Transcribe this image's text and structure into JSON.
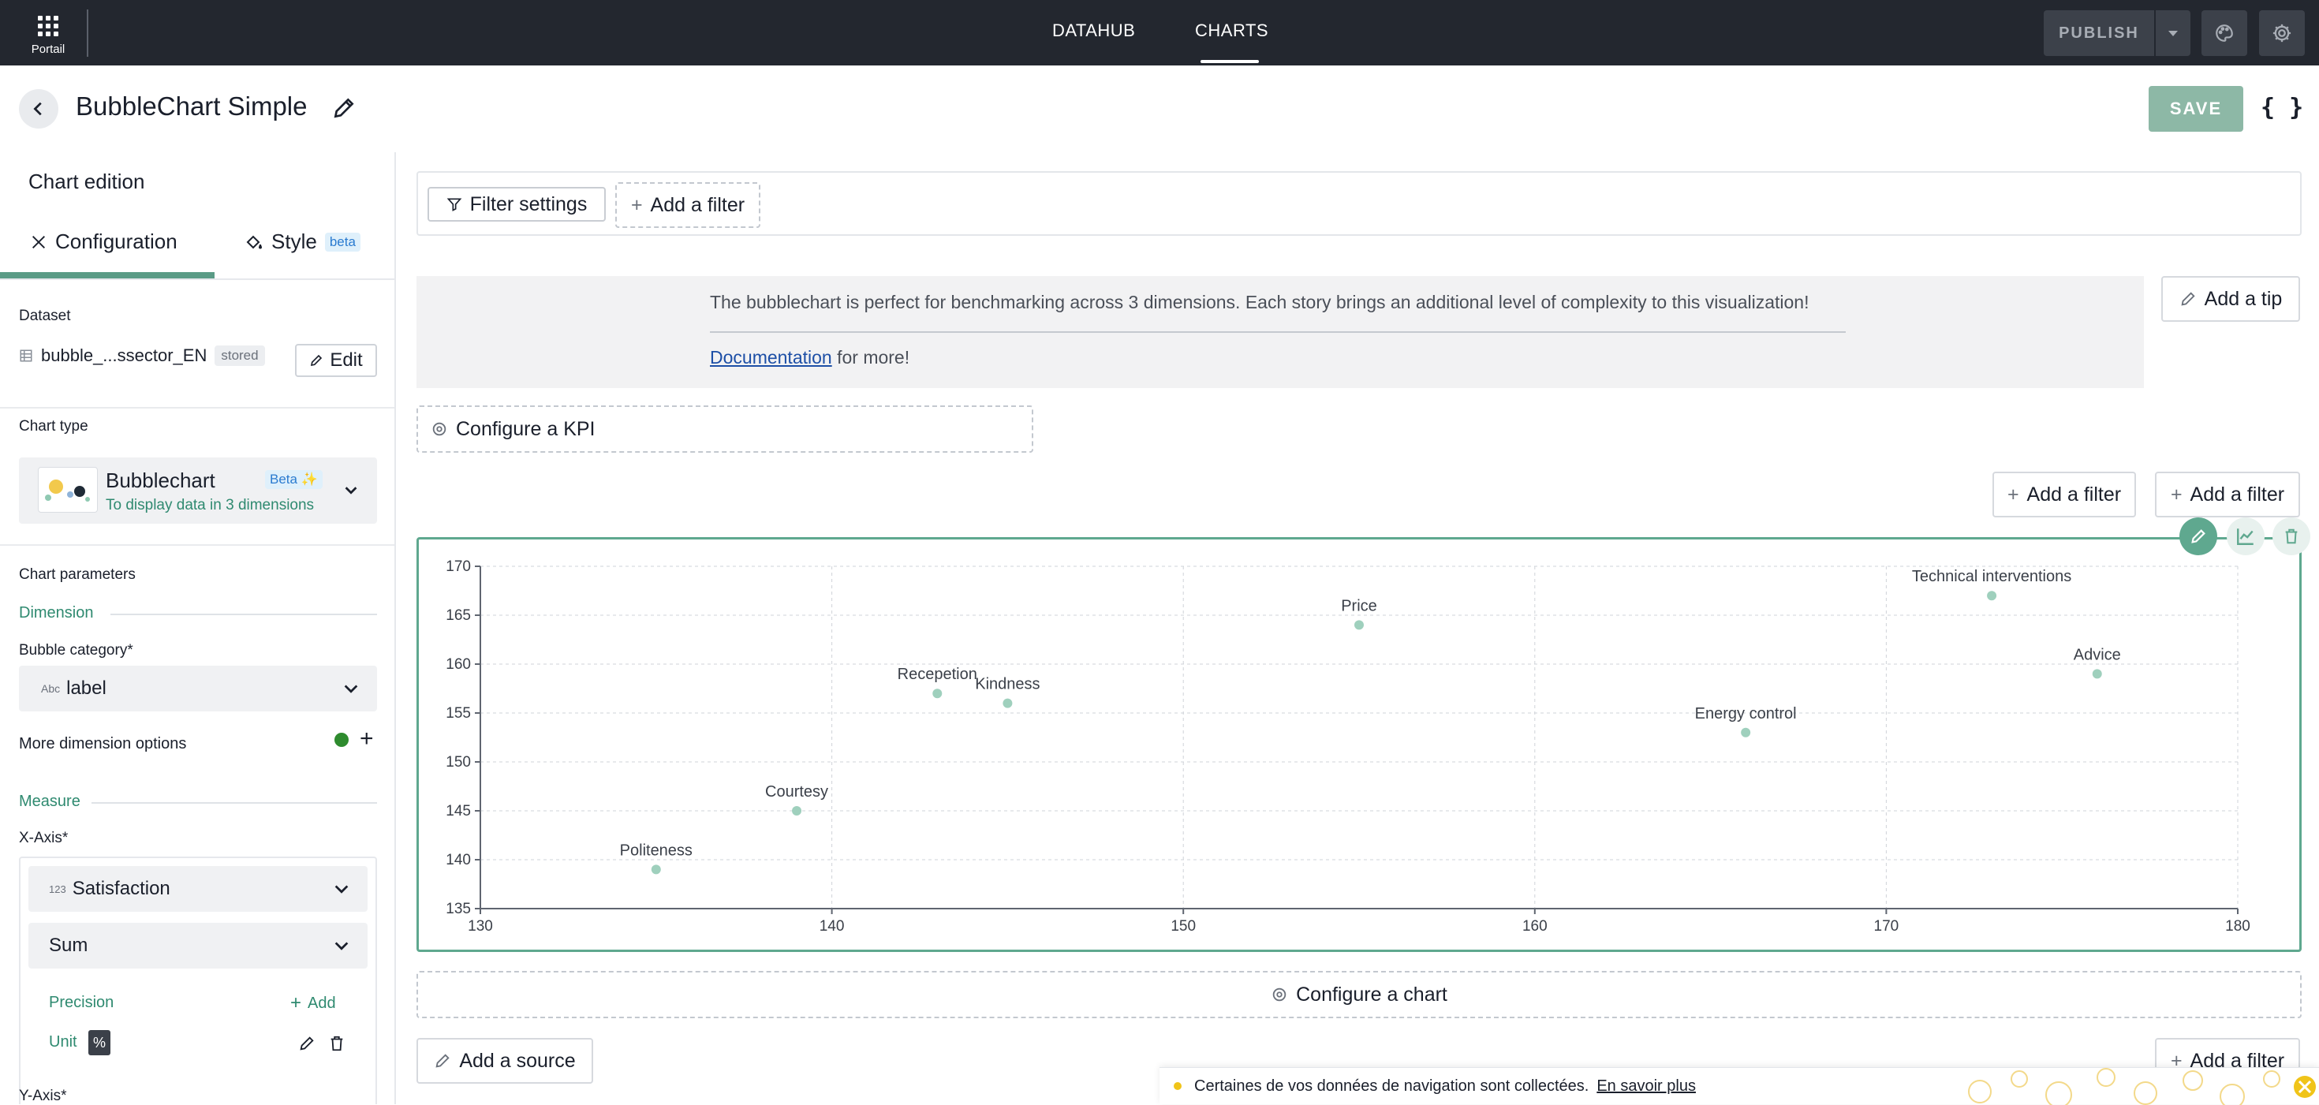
{
  "topbar": {
    "portal_label": "Portail",
    "nav": {
      "datahub": "DATAHUB",
      "charts": "CHARTS",
      "active": "CHARTS"
    },
    "publish_label": "PUBLISH"
  },
  "titlebar": {
    "title": "BubbleChart Simple",
    "save_label": "SAVE",
    "json_label": "{ }"
  },
  "sidebar": {
    "heading": "Chart edition",
    "tabs": {
      "configuration": "Configuration",
      "style": "Style",
      "style_badge": "beta"
    },
    "dataset": {
      "label": "Dataset",
      "name": "bubble_...ssector_EN",
      "badge": "stored",
      "edit_label": "Edit"
    },
    "chart_type": {
      "label": "Chart type",
      "name": "Bubblechart",
      "badge": "Beta ✨",
      "description": "To display data in 3 dimensions"
    },
    "parameters": {
      "label": "Chart parameters",
      "dimension_section": "Dimension",
      "bubble_category_label": "Bubble category*",
      "bubble_category_type": "Abc",
      "bubble_category_value": "label",
      "more_dimension_options": "More dimension options",
      "measure_section": "Measure",
      "x_axis_label": "X-Axis*",
      "x_axis_field_type": "123",
      "x_axis_field": "Satisfaction",
      "x_axis_aggregation": "Sum",
      "precision_label": "Precision",
      "precision_add": "Add",
      "unit_label": "Unit",
      "unit_value": "%",
      "y_axis_label": "Y-Axis*"
    }
  },
  "main": {
    "filter_settings_label": "Filter settings",
    "add_filter_label": "Add a filter",
    "tip": {
      "text": "The bubblechart is perfect for benchmarking across 3 dimensions. Each story brings an additional level of complexity to this visualization!",
      "doc_link": "Documentation",
      "doc_suffix": " for more!",
      "add_tip_label": "Add a tip"
    },
    "configure_kpi_label": "Configure a KPI",
    "configure_chart_label": "Configure a chart",
    "add_source_label": "Add a source"
  },
  "cookie_banner": {
    "text": "Certaines de vos données de navigation sont collectées.",
    "link": "En savoir plus"
  },
  "colors": {
    "accent": "#5fa88f",
    "topbar": "#23272f",
    "bubble": "#9fd0bd"
  },
  "chart_data": {
    "type": "scatter",
    "title": "",
    "xlabel": "",
    "ylabel": "",
    "xlim": [
      130,
      180
    ],
    "ylim": [
      135,
      170
    ],
    "x_ticks": [
      130,
      140,
      150,
      160,
      170,
      180
    ],
    "y_ticks": [
      135,
      140,
      145,
      150,
      155,
      160,
      165,
      170
    ],
    "grid": true,
    "points": [
      {
        "label": "Politeness",
        "x": 135,
        "y": 139
      },
      {
        "label": "Courtesy",
        "x": 139,
        "y": 145
      },
      {
        "label": "Recepetion",
        "x": 143,
        "y": 157
      },
      {
        "label": "Kindness",
        "x": 145,
        "y": 156
      },
      {
        "label": "Price",
        "x": 155,
        "y": 164
      },
      {
        "label": "Energy control",
        "x": 166,
        "y": 153
      },
      {
        "label": "Technical interventions",
        "x": 173,
        "y": 167
      },
      {
        "label": "Advice",
        "x": 176,
        "y": 159
      }
    ]
  }
}
